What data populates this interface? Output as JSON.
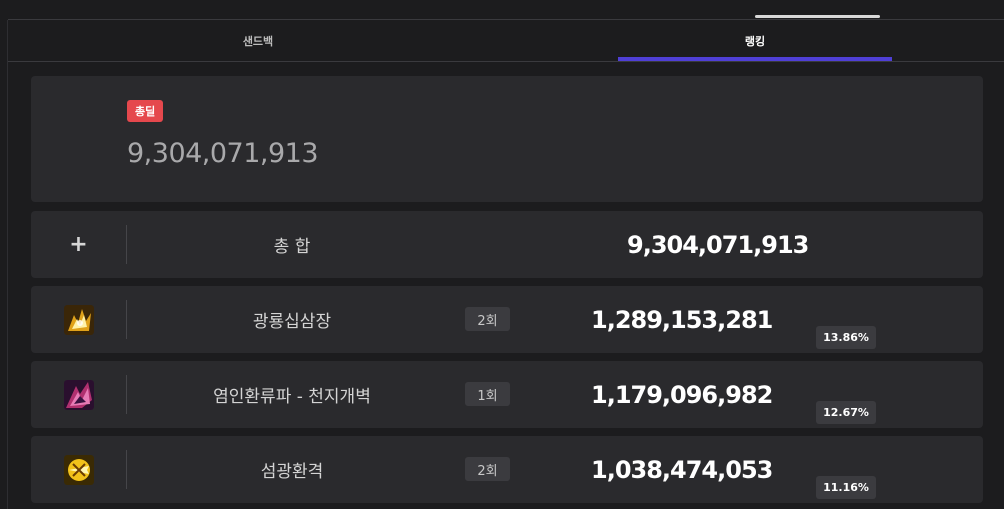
{
  "tabs": {
    "sandbag": "샌드백",
    "ranking": "랭킹"
  },
  "summary": {
    "badge": "총딜",
    "value": "9,304,071,913"
  },
  "total_row": {
    "icon": "plus-icon",
    "label": "총 합",
    "value": "9,304,071,913"
  },
  "skills": [
    {
      "icon": "skill-icon-gwangryong",
      "name": "광룡십삼장",
      "count": "2회",
      "damage": "1,289,153,281",
      "percent": "13.86%"
    },
    {
      "icon": "skill-icon-yeomin",
      "name": "염인환류파 - 천지개벽",
      "count": "1회",
      "damage": "1,179,096,982",
      "percent": "12.67%"
    },
    {
      "icon": "skill-icon-seomgwang",
      "name": "섬광환격",
      "count": "2회",
      "damage": "1,038,474,053",
      "percent": "11.16%"
    }
  ],
  "colors": {
    "background": "#1c1c1e",
    "card": "#2a2a2d",
    "accent_tab": "#4f3fd6",
    "total_badge": "#e5484d"
  }
}
